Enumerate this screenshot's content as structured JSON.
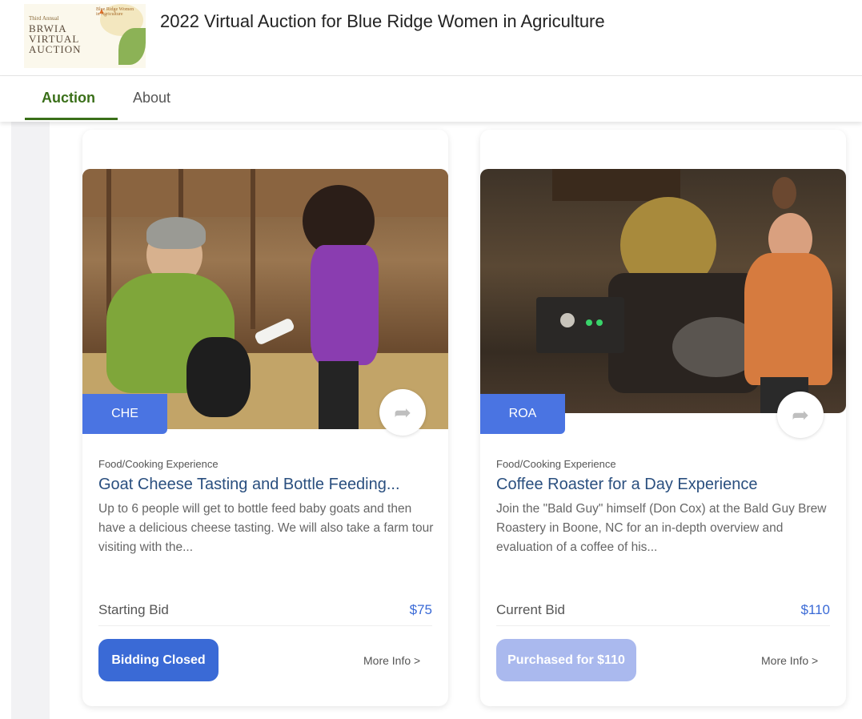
{
  "header": {
    "logo": {
      "line1": "Third Annual",
      "line2": "BRWIA",
      "line3": "VIRTUAL",
      "line4": "AUCTION",
      "org_small": "Blue Ridge Women in Agriculture"
    },
    "title": "2022 Virtual Auction for Blue Ridge Women in Agriculture"
  },
  "nav": {
    "tabs": [
      {
        "label": "Auction",
        "active": true
      },
      {
        "label": "About",
        "active": false
      }
    ],
    "accent": "#3a6f19"
  },
  "items": [
    {
      "code": "CHE",
      "category": "Food/Cooking Experience",
      "title": "Goat Cheese Tasting and Bottle Feeding...",
      "description": "Up to 6 people will get to bottle feed baby goats and then have a delicious cheese tasting. We will also take a farm tour visiting with the...",
      "bid_label": "Starting Bid",
      "bid_value": "$75",
      "action_label": "Bidding Closed",
      "more_info": "More Info >",
      "share_icon": "share-arrow-icon"
    },
    {
      "code": "ROA",
      "category": "Food/Cooking Experience",
      "title": "Coffee Roaster for a Day Experience",
      "description": "Join the \"Bald Guy\" himself (Don Cox) at the Bald Guy Brew Roastery in Boone, NC for an in-depth overview and evaluation of a coffee of his...",
      "bid_label": "Current Bid",
      "bid_value": "$110",
      "action_label": "Purchased for $110",
      "more_info": "More Info >",
      "share_icon": "share-arrow-icon"
    }
  ],
  "colors": {
    "badge": "#4a74e2",
    "price": "#3a6ad6",
    "button_primary": "#3a6ad6",
    "button_disabled": "#aab9ee",
    "title_link": "#2a4f7f"
  }
}
